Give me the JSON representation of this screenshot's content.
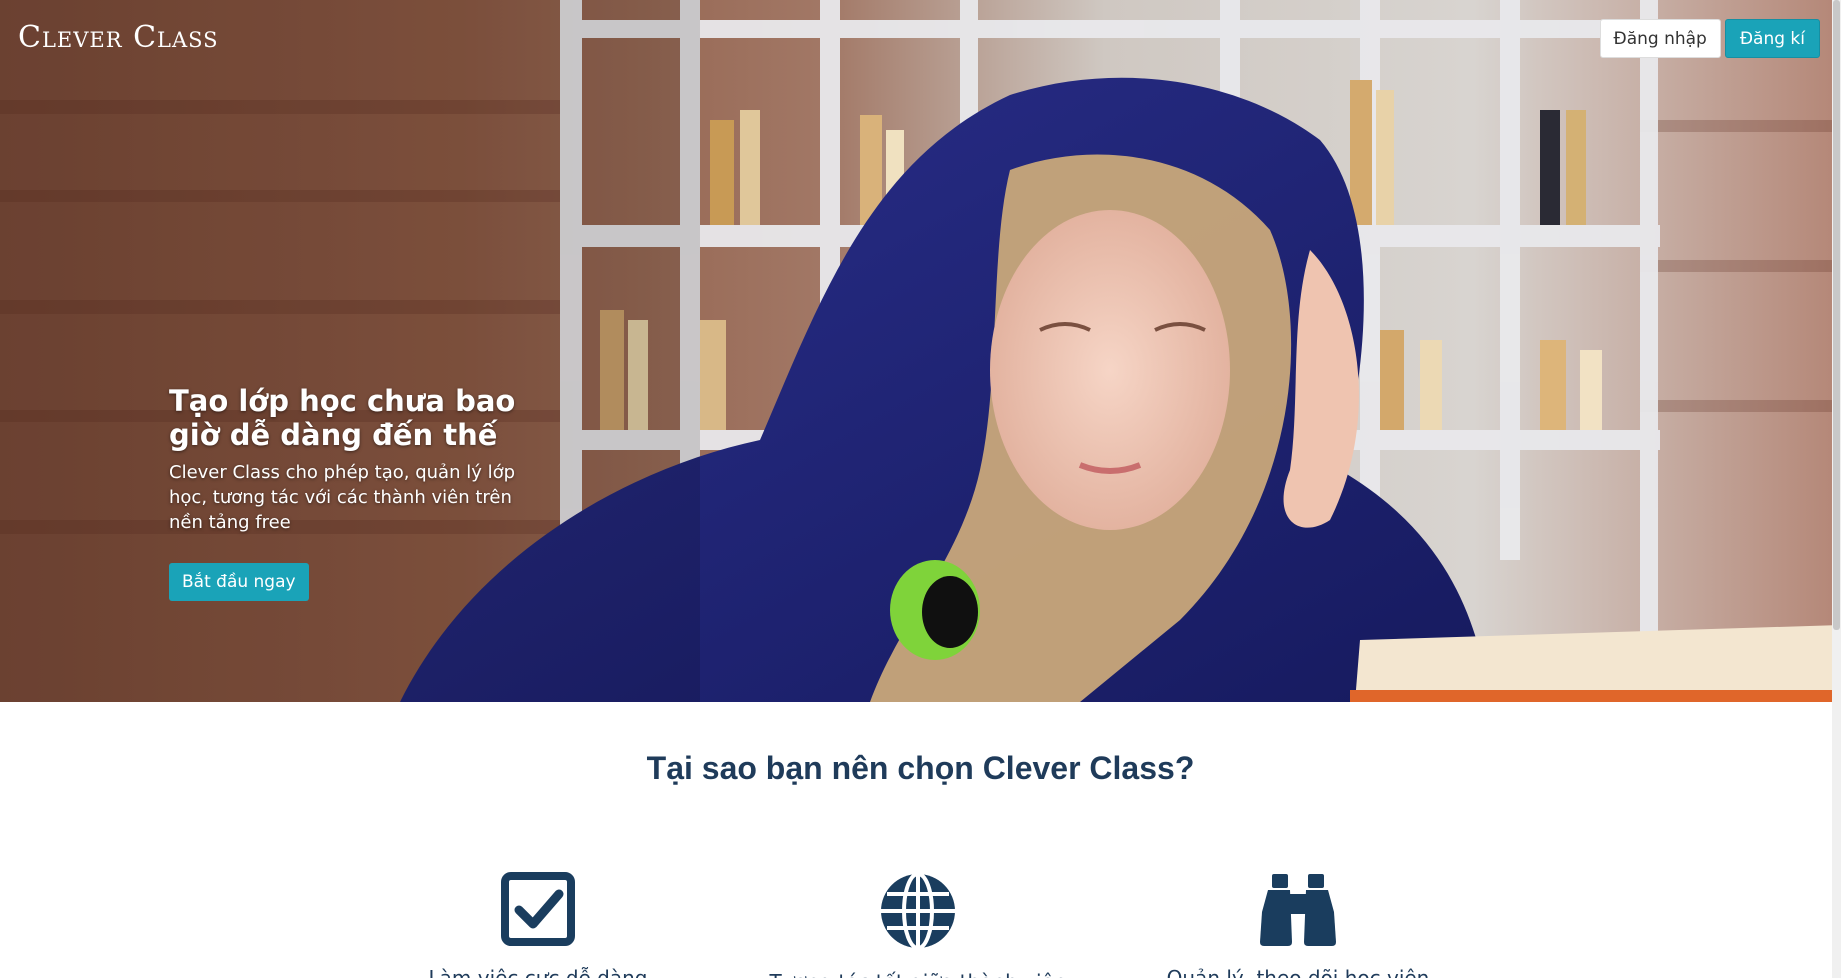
{
  "header": {
    "brand": "Clever Class",
    "login_label": "Đăng nhập",
    "signup_label": "Đăng kí"
  },
  "hero": {
    "title": "Tạo lớp học chưa bao giờ dễ dàng đến thế",
    "subtitle": "Clever Class cho phép tạo, quản lý lớp học, tương tác với các thành viên trên nền tảng free",
    "cta_label": "Bắt đầu ngay"
  },
  "why": {
    "title": "Tại sao bạn nên chọn Clever Class?",
    "features": [
      {
        "icon": "checkbox-icon",
        "label": "Làm việc cực dễ dàng"
      },
      {
        "icon": "globe-icon",
        "label": "Tương tác tốt giữa thành viên"
      },
      {
        "icon": "binoculars-icon",
        "label": "Quản lý, theo dõi học viên"
      }
    ]
  },
  "colors": {
    "accent": "#1aa3b8",
    "heading": "#1f3b5a",
    "icon": "#1a3d5e"
  }
}
